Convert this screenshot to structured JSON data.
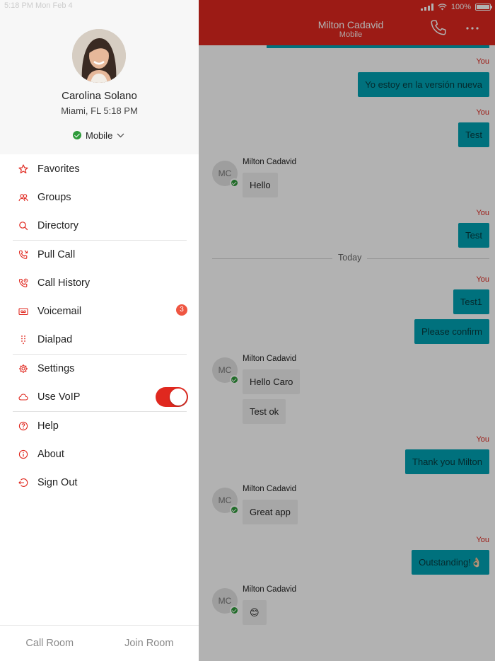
{
  "status_bar": {
    "time": "5:18 PM",
    "date": "Mon Feb 4",
    "battery": "100%"
  },
  "chat": {
    "header_title": "Milton Cadavid",
    "header_subtitle": "Mobile",
    "date_divider": "Today",
    "you_label": "You",
    "contact_initials": "MC",
    "messages": {
      "out_1": "Yo estoy en la versión nueva",
      "out_2": "Test",
      "in_1_sender": "Milton Cadavid",
      "in_1": "Hello",
      "out_3": "Test",
      "out_4": "Test1",
      "out_5": "Please confirm",
      "in_2_sender": "Milton Cadavid",
      "in_2a": "Hello Caro",
      "in_2b": "Test ok",
      "out_6": "Thank you Milton",
      "in_3_sender": "Milton Cadavid",
      "in_3": "Great app",
      "out_7": "Outstanding!👌🏻",
      "in_4_sender": "Milton Cadavid",
      "in_4": "😊"
    }
  },
  "profile": {
    "name": "Carolina Solano",
    "location": "Miami, FL 5:18 PM",
    "presence": "Mobile"
  },
  "menu": {
    "favorites": "Favorites",
    "groups": "Groups",
    "directory": "Directory",
    "pull_call": "Pull Call",
    "call_history": "Call History",
    "voicemail": "Voicemail",
    "voicemail_badge": "3",
    "dialpad": "Dialpad",
    "settings": "Settings",
    "use_voip": "Use VoIP",
    "use_voip_on": true,
    "help": "Help",
    "about": "About",
    "sign_out": "Sign Out"
  },
  "footer": {
    "call_room": "Call Room",
    "join_room": "Join Room"
  },
  "colors": {
    "brand_red": "#e0281f",
    "outgoing_bubble": "#00a3b3",
    "incoming_bubble": "#efefef",
    "presence_green": "#2e9b3a",
    "badge": "#ef5642"
  }
}
